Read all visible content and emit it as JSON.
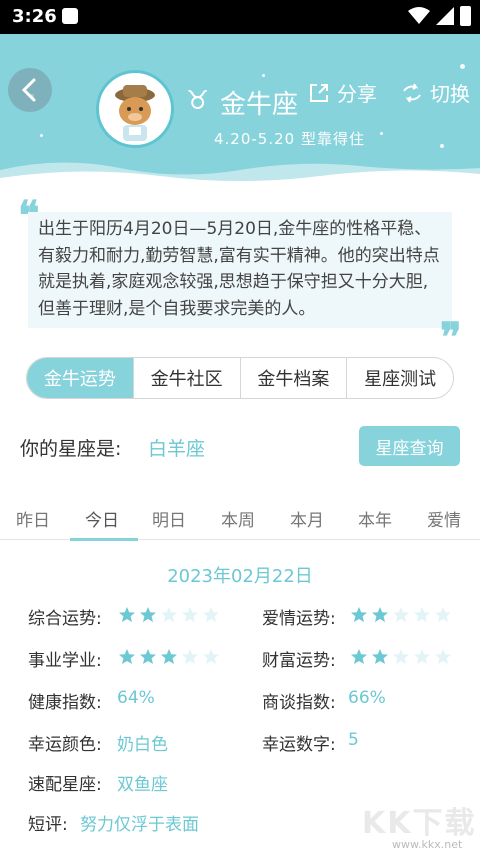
{
  "status": {
    "time": "3:26"
  },
  "header": {
    "sign_glyph": "♉",
    "sign_name": "金牛座",
    "date_range": "4.20-5.20 型靠得住",
    "share_label": "分享",
    "switch_label": "切换"
  },
  "description": "出生于阳历4月20日—5月20日,金牛座的性格平稳、有毅力和耐力,勤劳智慧,富有实干精神。他的突出特点就是执着,家庭观念较强,思想趋于保守担又十分大胆,但善于理财,是个自我要求完美的人。",
  "quote_open": "❝",
  "quote_close": "❞",
  "tabs": [
    {
      "label": "金牛运势",
      "active": true
    },
    {
      "label": "金牛社区",
      "active": false
    },
    {
      "label": "金牛档案",
      "active": false
    },
    {
      "label": "星座测试",
      "active": false
    }
  ],
  "my_sign": {
    "label": "你的星座是:",
    "value": "白羊座",
    "query_button": "星座查询"
  },
  "days": [
    "昨日",
    "今日",
    "明日",
    "本周",
    "本月",
    "本年",
    "爱情"
  ],
  "active_day": "今日",
  "date": "2023年02月22日",
  "fortune": {
    "overall": {
      "label": "综合运势:",
      "stars": 2,
      "max": 5
    },
    "love": {
      "label": "爱情运势:",
      "stars": 2,
      "max": 5
    },
    "career": {
      "label": "事业学业:",
      "stars": 3,
      "max": 5
    },
    "wealth": {
      "label": "财富运势:",
      "stars": 2,
      "max": 5
    },
    "health": {
      "label": "健康指数:",
      "value": "64%"
    },
    "negotiation": {
      "label": "商谈指数:",
      "value": "66%"
    },
    "lucky_color": {
      "label": "幸运颜色:",
      "value": "奶白色"
    },
    "lucky_number": {
      "label": "幸运数字:",
      "value": "5"
    },
    "match": {
      "label": "速配星座:",
      "value": "双鱼座"
    },
    "comment": {
      "label": "短评:",
      "value": "努力仅浮于表面"
    }
  },
  "watermark": {
    "text": "KK下载",
    "url": "www.kkx.net"
  },
  "colors": {
    "accent": "#86d3dc",
    "accent_text": "#6cc8d3",
    "star_on": "#6cc8d3",
    "star_off": "#e3f4f6"
  }
}
